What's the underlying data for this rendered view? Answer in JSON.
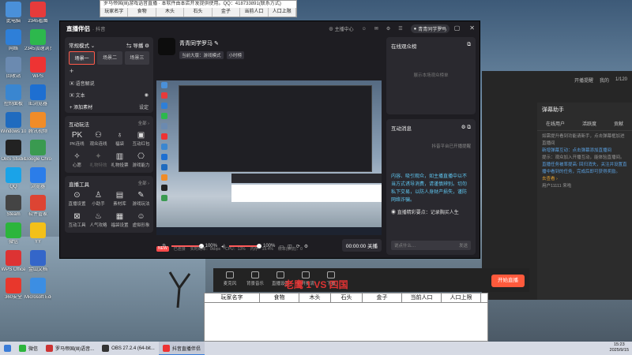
{
  "desktop": {
    "icons": [
      {
        "label": "此电脑",
        "color": "#4a90d9"
      },
      {
        "label": "2345看图",
        "color": "#e63b3b"
      },
      {
        "label": "网络",
        "color": "#2e7fd8"
      },
      {
        "label": "2345加速浏览器",
        "color": "#2db84d"
      },
      {
        "label": "回收站",
        "color": "#6b8ab0"
      },
      {
        "label": "WPS",
        "color": "#e33"
      },
      {
        "label": "控制面板",
        "color": "#3a86d0"
      },
      {
        "label": "IE浏览器",
        "color": "#1e6fd1"
      },
      {
        "label": "Windows 10",
        "color": "#1f6bbf"
      },
      {
        "label": "腾讯视频",
        "color": "#f08c28"
      },
      {
        "label": "OBS Studio",
        "color": "#222"
      },
      {
        "label": "Google Chrome",
        "color": "#3a9a50"
      },
      {
        "label": "QQ",
        "color": "#1aa3e8"
      },
      {
        "label": "浏览器",
        "color": "#2b7de9"
      },
      {
        "label": "Steam",
        "color": "#444"
      },
      {
        "label": "软件管家",
        "color": "#d43"
      },
      {
        "label": "微信",
        "color": "#2cb53c"
      },
      {
        "label": "YY",
        "color": "#f3c019"
      },
      {
        "label": "WPS Office",
        "color": "#d33"
      },
      {
        "label": "金山文档",
        "color": "#3466c9"
      },
      {
        "label": "360安全",
        "color": "#e8372c"
      },
      {
        "label": "Microsoft Edge",
        "color": "#3c8ee3"
      }
    ]
  },
  "bg_table": {
    "title": "罗马帝国(Ⅲ)游戏语音直播 · 本软件由本店开发提供使用。QQ：418733891(联系方式)",
    "headers": [
      "玩家名字",
      "食物",
      "木头",
      "石头",
      "金子",
      "当前人口",
      "人口上限"
    ]
  },
  "main_window": {
    "app_name": "直播伴侣",
    "app_sub": "· 抖音",
    "title_icons": [
      "主播中心",
      "帮助",
      "设置"
    ],
    "user_name": "青青同学罗马",
    "left": {
      "mode_label": "常规模式",
      "mode_right": "导播",
      "scenes": [
        "场景一",
        "场景二",
        "场景三"
      ],
      "sources": [
        {
          "label": "语音解说",
          "eye": ""
        },
        {
          "label": "文本",
          "eye": "◉"
        }
      ],
      "add_source": "添加素材",
      "add_source_right": "设定",
      "interact_title": "互动玩法",
      "more": "全部 ›",
      "interact_tools": [
        {
          "label": "PK连线",
          "glyph": "PK",
          "dim": false
        },
        {
          "label": "观众连线",
          "glyph": "⚇",
          "dim": false
        },
        {
          "label": "福袋",
          "glyph": "♁",
          "dim": false
        },
        {
          "label": "互动红包",
          "glyph": "▣",
          "dim": false
        },
        {
          "label": "心愿",
          "glyph": "✧",
          "dim": false
        },
        {
          "label": "礼物特效",
          "glyph": "✦",
          "dim": true
        },
        {
          "label": "礼物投票",
          "glyph": "▥",
          "dim": false
        },
        {
          "label": "游戏能力",
          "glyph": "⎔",
          "dim": false
        }
      ],
      "tools_title": "直播工具",
      "live_tools": [
        {
          "label": "直播设置",
          "glyph": "⊙"
        },
        {
          "label": "小助手",
          "glyph": "♙"
        },
        {
          "label": "素材库",
          "glyph": "▤"
        },
        {
          "label": "游戏玩法",
          "glyph": "✎"
        },
        {
          "label": "互动工具",
          "glyph": "⊠"
        },
        {
          "label": "人气攻略",
          "glyph": "♨"
        },
        {
          "label": "福袋设置",
          "glyph": "▦"
        },
        {
          "label": "虚拟形象",
          "glyph": "☺"
        }
      ]
    },
    "center": {
      "room_name": "青青同学罗马",
      "tags": [
        "当前大版：游戏模式",
        "小时榜"
      ],
      "mic_volume": "100%",
      "speaker_volume": "100%",
      "mic_level": 1.0,
      "speaker_level": 1.0,
      "timer": "00:00:00",
      "timer_label": "关播",
      "status": [
        "NEW",
        "已连接",
        "实时码率：0kbps",
        "CPU：13%",
        "内存：19.4%",
        "帧率(推流)：0"
      ]
    },
    "right": {
      "online_title": "在线观众榜",
      "online_empty": "展示本场观众榜单",
      "interact_title": "互动消息",
      "system_msg": "抖音平台已开播提醒",
      "warn_msg": "内容、吸引观众，如主播直播中以不当方式诱导消费，请谨慎辨别。切勿私下交易，以防人身财产损失，谨防网络诈骗。",
      "bot_msg": "直播精彩要点：记录胸买人生",
      "chat_placeholder": "说点什么…",
      "send": "发送"
    }
  },
  "right_app": {
    "top_items": [
      "开播提醒",
      "我的",
      "1/120"
    ],
    "danmu_title": "弹幕助手",
    "tabs": [
      "在线用户",
      "活跃度",
      "贡献"
    ],
    "lines": [
      "如需提升看到功能请新手，点击弹幕框加进直播间",
      "新增弹幕互动：点击弹幕添加直播间",
      "提示：观众加入开播互动，能体验直播间。",
      "直播任务被率提高: 回归消失，关注并设置直播中看到的任务，完成后即可获得奖励。",
      "去查看 ›",
      "用户11111 来啦"
    ],
    "start_live": "开始直播"
  },
  "obs_bar": {
    "buttons": [
      "麦克风",
      "背景音乐",
      "直播设置",
      "打开推流",
      "下播"
    ],
    "overlay": "老鹰 1 VS 四国",
    "mic_vol": "100%",
    "spk_vol": "100%"
  },
  "sheet": {
    "headers": [
      "玩家名字",
      "食物",
      "木头",
      "石头",
      "金子",
      "当前人口",
      "人口上限"
    ]
  },
  "taskbar": {
    "items": [
      {
        "label": "微信",
        "color": "#2cb53c"
      },
      {
        "label": "罗马帝国(Ⅲ)语音...",
        "color": "#c33"
      },
      {
        "label": "OBS 27.2.4 (64-bit...",
        "color": "#333"
      },
      {
        "label": "抖音直播伴侣",
        "color": "#e33"
      }
    ],
    "time": "15:23",
    "date": "2025/9/15"
  }
}
